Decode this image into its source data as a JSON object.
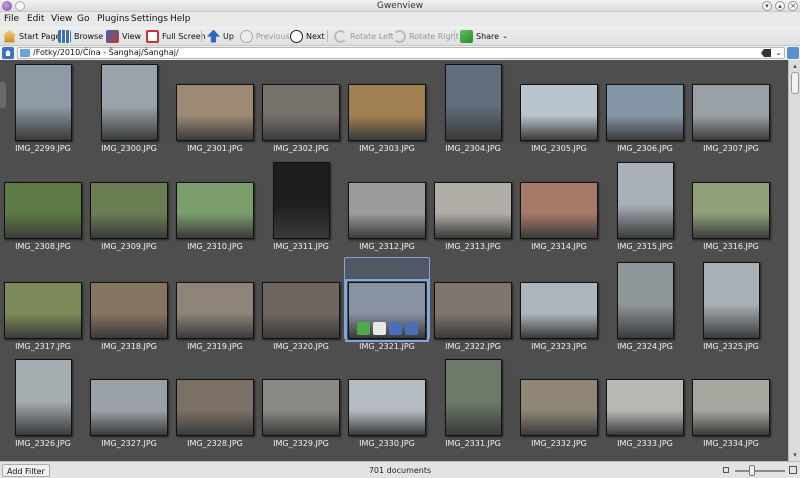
{
  "window": {
    "title": "Gwenview"
  },
  "menu": [
    "File",
    "Edit",
    "View",
    "Go",
    "Plugins",
    "Settings",
    "Help"
  ],
  "toolbar": {
    "start_page": "Start Page",
    "browse": "Browse",
    "view": "View",
    "full_screen": "Full Screen",
    "up": "Up",
    "previous": "Previous",
    "next": "Next",
    "rotate_left": "Rotate Left",
    "rotate_right": "Rotate Right",
    "share": "Share"
  },
  "location": {
    "path": "/Fotky/2010/Čína - Šanghaj/Šanghaj/"
  },
  "thumbnails": [
    {
      "name": "IMG_2299.JPG",
      "o": "p",
      "c": "#8e9aa6"
    },
    {
      "name": "IMG_2300.JPG",
      "o": "p",
      "c": "#9aa3aa"
    },
    {
      "name": "IMG_2301.JPG",
      "o": "l",
      "c": "#9c8a74"
    },
    {
      "name": "IMG_2302.JPG",
      "o": "l",
      "c": "#77716c"
    },
    {
      "name": "IMG_2303.JPG",
      "o": "l",
      "c": "#a08050"
    },
    {
      "name": "IMG_2304.JPG",
      "o": "p",
      "c": "#5f6e7a"
    },
    {
      "name": "IMG_2305.JPG",
      "o": "l",
      "c": "#b9c4cc"
    },
    {
      "name": "IMG_2306.JPG",
      "o": "l",
      "c": "#8596a6"
    },
    {
      "name": "IMG_2307.JPG",
      "o": "l",
      "c": "#9aa1a6"
    },
    {
      "name": "IMG_2308.JPG",
      "o": "l",
      "c": "#5e7a44"
    },
    {
      "name": "IMG_2309.JPG",
      "o": "l",
      "c": "#6b7d53"
    },
    {
      "name": "IMG_2310.JPG",
      "o": "l",
      "c": "#7b9e6c"
    },
    {
      "name": "IMG_2311.JPG",
      "o": "p",
      "c": "#1e1e1e"
    },
    {
      "name": "IMG_2312.JPG",
      "o": "l",
      "c": "#9c9c9c"
    },
    {
      "name": "IMG_2313.JPG",
      "o": "l",
      "c": "#b0aea7"
    },
    {
      "name": "IMG_2314.JPG",
      "o": "l",
      "c": "#a77a68"
    },
    {
      "name": "IMG_2315.JPG",
      "o": "p",
      "c": "#a9b0b8"
    },
    {
      "name": "IMG_2316.JPG",
      "o": "l",
      "c": "#8fa07a"
    },
    {
      "name": "IMG_2317.JPG",
      "o": "l",
      "c": "#7d8b5a"
    },
    {
      "name": "IMG_2318.JPG",
      "o": "l",
      "c": "#867462"
    },
    {
      "name": "IMG_2319.JPG",
      "o": "l",
      "c": "#8e8478"
    },
    {
      "name": "IMG_2320.JPG",
      "o": "l",
      "c": "#6e6760"
    },
    {
      "name": "IMG_2321.JPG",
      "o": "l",
      "c": "#8992a0",
      "selected": true
    },
    {
      "name": "IMG_2322.JPG",
      "o": "l",
      "c": "#7f7670"
    },
    {
      "name": "IMG_2323.JPG",
      "o": "l",
      "c": "#aeb6bd"
    },
    {
      "name": "IMG_2324.JPG",
      "o": "p",
      "c": "#8f969a"
    },
    {
      "name": "IMG_2325.JPG",
      "o": "p",
      "c": "#a9b1b7"
    },
    {
      "name": "IMG_2326.JPG",
      "o": "p",
      "c": "#a6adb1"
    },
    {
      "name": "IMG_2327.JPG",
      "o": "l",
      "c": "#9aa2a8"
    },
    {
      "name": "IMG_2328.JPG",
      "o": "l",
      "c": "#7b7064"
    },
    {
      "name": "IMG_2329.JPG",
      "o": "l",
      "c": "#8a8a84"
    },
    {
      "name": "IMG_2330.JPG",
      "o": "l",
      "c": "#b4bcc1"
    },
    {
      "name": "IMG_2331.JPG",
      "o": "p",
      "c": "#6d7a6a"
    },
    {
      "name": "IMG_2332.JPG",
      "o": "l",
      "c": "#8f8678"
    },
    {
      "name": "IMG_2333.JPG",
      "o": "l",
      "c": "#b7b9b5"
    },
    {
      "name": "IMG_2334.JPG",
      "o": "l",
      "c": "#a5a89f"
    }
  ],
  "status": {
    "add_filter": "Add Filter",
    "document_count": "701 documents"
  }
}
